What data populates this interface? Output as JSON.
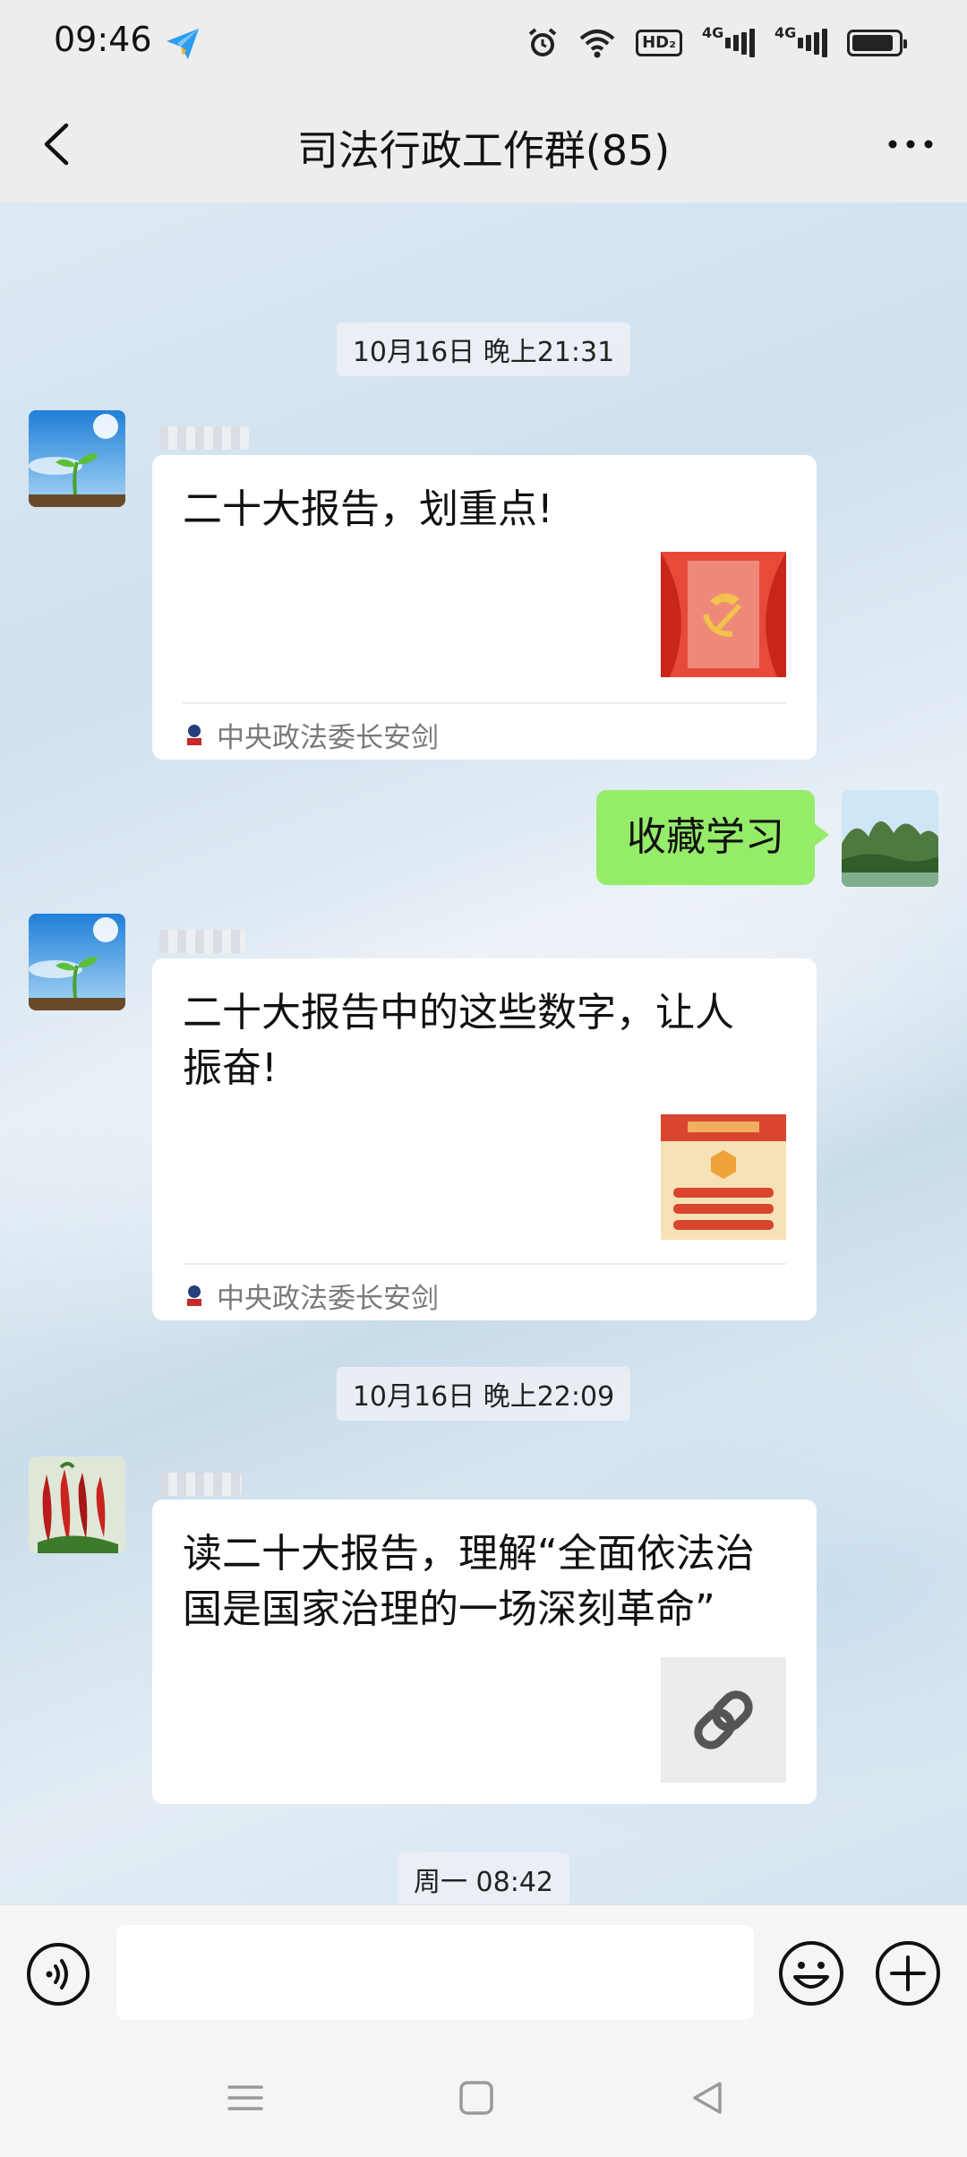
{
  "status_bar": {
    "time": "09:46",
    "hd_label": "HD₂",
    "signal_1_label": "4G",
    "signal_2_label": "4G",
    "battery_level": 0.9
  },
  "header": {
    "title": "司法行政工作群(85)"
  },
  "chat": {
    "timestamps": [
      "10月16日 晚上21:31",
      "10月16日 晚上22:09",
      "周一 08:42"
    ],
    "messages": [
      {
        "type": "link-card",
        "text": "二十大报告，划重点!",
        "source": "中央政法委长安剑",
        "thumbnail": "party-emblem"
      },
      {
        "type": "text-self",
        "text": "收藏学习"
      },
      {
        "type": "link-card",
        "text": "二十大报告中的这些数字，让人振奋!",
        "source": "中央政法委长安剑",
        "thumbnail": "report-numbers"
      },
      {
        "type": "link-card",
        "text": "读二十大报告，理解“全面依法治国是国家治理的一场深刻革命”",
        "thumbnail": "link-icon"
      }
    ]
  },
  "icons": {
    "back": "chevron-left-icon",
    "more": "more-icon",
    "voice": "voice-icon",
    "emoji": "emoji-icon",
    "plus": "plus-icon"
  },
  "colors": {
    "self_bubble": "#95ec69",
    "header_bg": "#ededed"
  }
}
